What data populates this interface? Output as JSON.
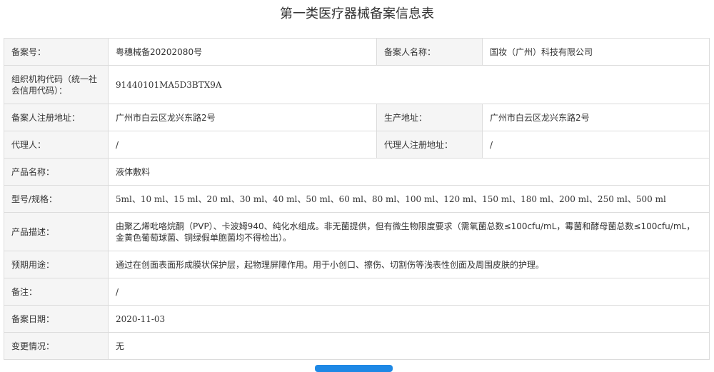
{
  "title": "第一类医疗器械备案信息表",
  "colors": {
    "label_bg": "#f5f5f5",
    "border": "#dcdcdc",
    "button": "#1e88e5"
  },
  "rows": {
    "record_no": {
      "label": "备案号：",
      "value": "粤穗械备20202080号"
    },
    "applicant": {
      "label": "备案人名称：",
      "value": "国妆（广州）科技有限公司"
    },
    "org_code": {
      "label": "组织机构代码（统一社会信用代码）：",
      "value": "91440101MA5D3BTX9A"
    },
    "reg_address": {
      "label": "备案人注册地址：",
      "value": "广州市白云区龙兴东路2号"
    },
    "prod_address": {
      "label": "生产地址：",
      "value": "广州市白云区龙兴东路2号"
    },
    "agent": {
      "label": "代理人：",
      "value": "/"
    },
    "agent_address": {
      "label": "代理人注册地址：",
      "value": "/"
    },
    "product_name": {
      "label": "产品名称：",
      "value": "液体敷料"
    },
    "model_spec": {
      "label": "型号/规格：",
      "value": "5ml、10 ml、15 ml、20 ml、30 ml、40 ml、50 ml、60 ml、80 ml、100 ml、120 ml、150 ml、180 ml、200 ml、250 ml、500 ml"
    },
    "description": {
      "label": "产品描述：",
      "value": "由聚乙烯吡咯烷酮（PVP）、卡波姆940、纯化水组成。非无菌提供，但有微生物限度要求（需氧菌总数≤100cfu/mL，霉菌和酵母菌总数≤100cfu/mL，金黄色葡萄球菌、铜绿假单胞菌均不得检出）。"
    },
    "intended_use": {
      "label": "预期用途：",
      "value": "通过在创面表面形成膜状保护层，起物理屏障作用。用于小创口、擦伤、切割伤等浅表性创面及周围皮肤的护理。"
    },
    "remark": {
      "label": "备注：",
      "value": "/"
    },
    "record_date": {
      "label": "备案日期：",
      "value": "2020-11-03"
    },
    "change": {
      "label": "变更情况：",
      "value": "无"
    }
  }
}
